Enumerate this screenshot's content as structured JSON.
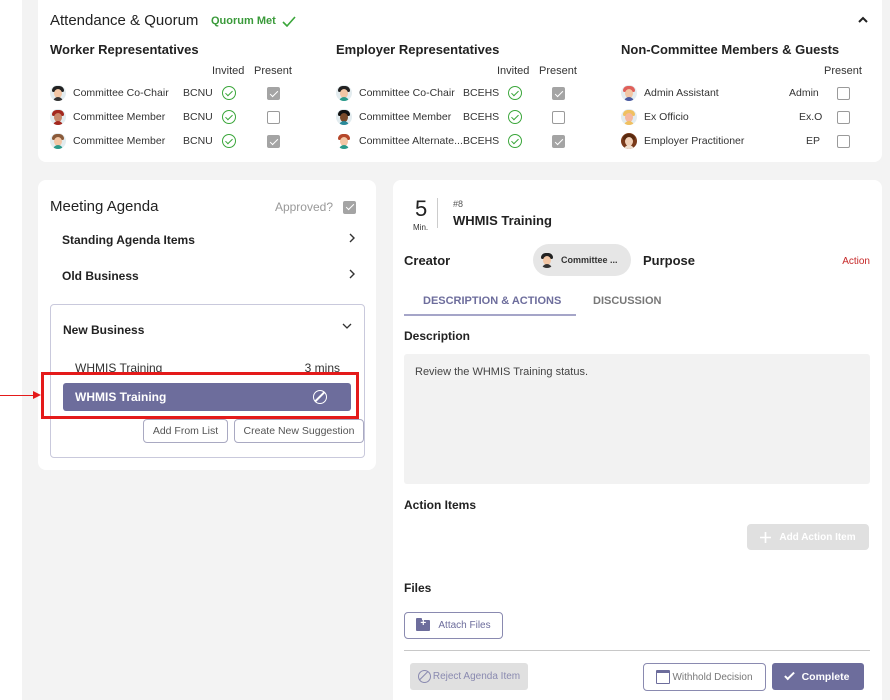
{
  "attendance": {
    "title": "Attendance & Quorum",
    "quorum_status": "Quorum Met",
    "collapse_icon": "chevron-up-icon",
    "groups": [
      {
        "title": "Worker Representatives",
        "headers": {
          "invited": "Invited",
          "present": "Present"
        },
        "members": [
          {
            "role": "Committee Co-Chair",
            "org": "BCNU",
            "invited": true,
            "present": true
          },
          {
            "role": "Committee Member",
            "org": "BCNU",
            "invited": true,
            "present": false
          },
          {
            "role": "Committee Member",
            "org": "BCNU",
            "invited": true,
            "present": true
          }
        ]
      },
      {
        "title": "Employer Representatives",
        "headers": {
          "invited": "Invited",
          "present": "Present"
        },
        "members": [
          {
            "role": "Committee Co-Chair",
            "org": "BCEHS",
            "invited": true,
            "present": true
          },
          {
            "role": "Committee Member",
            "org": "BCEHS",
            "invited": true,
            "present": false
          },
          {
            "role": "Committee Alternate...",
            "org": "BCEHS",
            "invited": true,
            "present": true
          }
        ]
      },
      {
        "title": "Non-Committee Members & Guests",
        "headers": {
          "present": "Present"
        },
        "members": [
          {
            "role": "Admin Assistant",
            "org": "Admin",
            "present": false
          },
          {
            "role": "Ex Officio",
            "org": "Ex.O",
            "present": false
          },
          {
            "role": "Employer Practitioner",
            "org": "EP",
            "present": false
          }
        ]
      }
    ]
  },
  "agenda": {
    "title": "Meeting Agenda",
    "approved_label": "Approved?",
    "approved": true,
    "sections": [
      {
        "label": "Standing Agenda Items",
        "expanded": false
      },
      {
        "label": "Old Business",
        "expanded": false
      },
      {
        "label": "New Business",
        "expanded": true
      }
    ],
    "new_business_items": [
      {
        "title": "WHMIS Training",
        "duration": "3 mins"
      }
    ],
    "selected_item": {
      "title": "WHMIS Training",
      "icon": "block-icon"
    },
    "buttons": {
      "add_from_list": "Add From List",
      "create_suggestion": "Create New Suggestion"
    }
  },
  "detail": {
    "duration_value": "5",
    "duration_unit": "Min.",
    "item_number": "#8",
    "item_title": "WHMIS Training",
    "creator_label": "Creator",
    "creator_name": "Committee ...",
    "purpose_label": "Purpose",
    "purpose_value": "Action",
    "tabs": [
      {
        "label": "DESCRIPTION & ACTIONS",
        "active": true
      },
      {
        "label": "DISCUSSION",
        "active": false
      }
    ],
    "description_label": "Description",
    "description_text": "Review the WHMIS Training status.",
    "action_items_label": "Action Items",
    "add_action_item": "Add Action Item",
    "files_label": "Files",
    "attach_files": "Attach Files",
    "reject_button": "Reject Agenda Item",
    "withhold_button": "Withhold Decision",
    "complete_button": "Complete"
  },
  "colors": {
    "accent": "#6d6d9c",
    "success": "#3aa63a",
    "purpose_action": "#c62828",
    "annotation": "#e41a1a"
  }
}
